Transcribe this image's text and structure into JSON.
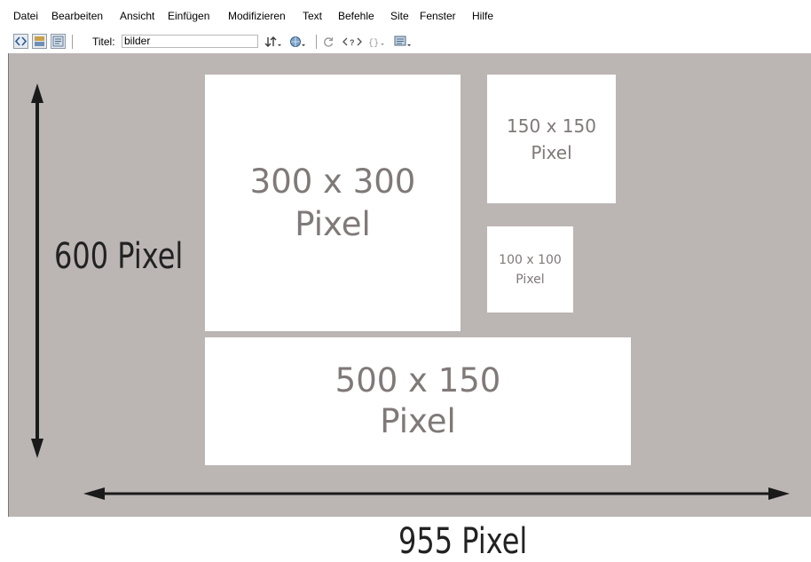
{
  "menu": {
    "items": [
      "Datei",
      "Bearbeiten",
      "Ansicht",
      "Einfügen",
      "Modifizieren",
      "Text",
      "Befehle",
      "Site",
      "Fenster",
      "Hilfe"
    ]
  },
  "toolbar": {
    "title_label": "Titel:",
    "title_value": "bilder",
    "icons": [
      "code-view-icon",
      "split-view-icon",
      "design-view-icon",
      "file-management-icon",
      "preview-browser-icon",
      "refresh-icon",
      "validate-markup-icon",
      "code-navigation-icon",
      "visual-aids-icon"
    ]
  },
  "boxes": {
    "b300": {
      "line1": "300 x 300",
      "line2": "Pixel"
    },
    "b150": {
      "line1": "150 x 150",
      "line2": "Pixel"
    },
    "b100": {
      "line1": "100 x 100",
      "line2": "Pixel"
    },
    "b500": {
      "line1": "500 x 150",
      "line2": "Pixel"
    }
  },
  "dimensions": {
    "height_label": "600 Pixel",
    "width_label": "955 Pixel"
  },
  "colors": {
    "canvas": "#bbb5b4",
    "box": "#ffffff",
    "box_text": "#7f7978",
    "arrow": "#1a1a1a"
  }
}
